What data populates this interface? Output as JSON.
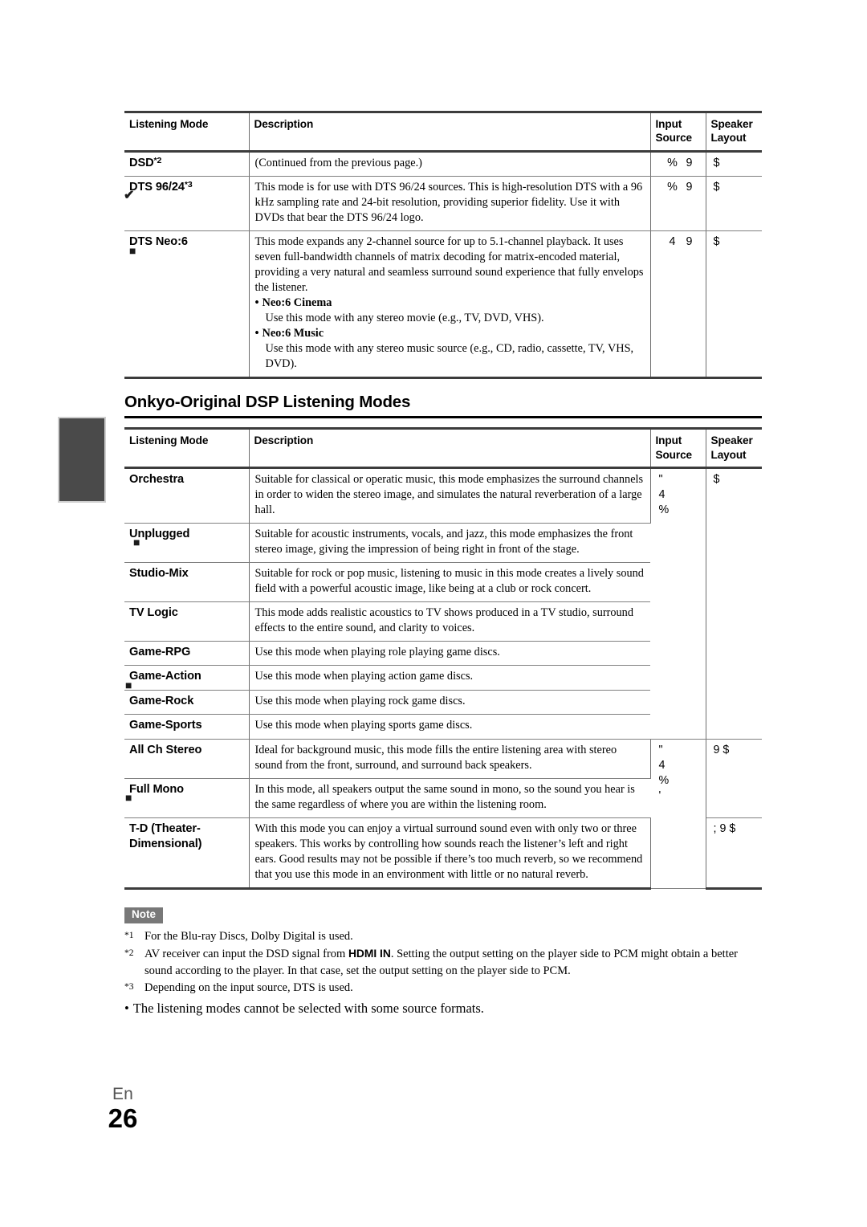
{
  "page": {
    "language_label": "En",
    "page_number": "26"
  },
  "section_heading": "Onkyo-Original DSP Listening Modes",
  "table_headers": {
    "mode": "Listening Mode",
    "description": "Description",
    "input_source_line1": "Input",
    "input_source_line2": "Source",
    "speaker_layout_line1": "Speaker",
    "speaker_layout_line2": "Layout"
  },
  "table1": {
    "rows": [
      {
        "mode": "DSD",
        "mode_sup": "*2",
        "description": "(Continued from the previous page.)",
        "input_source": [
          "%",
          "9"
        ],
        "speaker_layout": "$"
      },
      {
        "mode": "DTS 96/24",
        "mode_sup": "*3",
        "description": "This mode is for use with DTS 96/24 sources. This is high-resolution DTS with a 96 kHz sampling rate and 24-bit resolution, providing superior fidelity. Use it with DVDs that bear the DTS 96/24 logo.",
        "input_source": [
          "%",
          "9"
        ],
        "speaker_layout": "$"
      },
      {
        "mode": "DTS Neo:6",
        "mode_sup": "",
        "description": "This mode expands any 2-channel source for up to 5.1-channel playback. It uses seven full-bandwidth channels of matrix decoding for matrix-encoded material, providing a very natural and seamless surround sound experience that fully envelops the listener.",
        "bullets": [
          {
            "head": "Neo:6 Cinema",
            "body": "Use this mode with any stereo movie (e.g., TV, DVD, VHS)."
          },
          {
            "head": "Neo:6 Music",
            "body": "Use this mode with any stereo music source (e.g., CD, radio, cassette, TV, VHS, DVD)."
          }
        ],
        "input_source": [
          "4",
          "9"
        ],
        "speaker_layout": "$"
      }
    ]
  },
  "table2": {
    "rows": [
      {
        "mode": "Orchestra",
        "description": "Suitable for classical or operatic music, this mode emphasizes the surround channels in order to widen the stereo image, and simulates the natural reverberation of a large hall.",
        "input_source_stack": [
          "\"",
          "4",
          "%"
        ],
        "speaker_layout": "$"
      },
      {
        "mode": "Unplugged",
        "description": "Suitable for acoustic instruments, vocals, and jazz, this mode emphasizes the front stereo image, giving the impression of being right in front of the stage."
      },
      {
        "mode": "Studio-Mix",
        "description": "Suitable for rock or pop music, listening to music in this mode creates a lively sound field with a powerful acoustic image, like being at a club or rock concert."
      },
      {
        "mode": "TV Logic",
        "description": "This mode adds realistic acoustics to TV shows produced in a TV studio, surround effects to the entire sound, and clarity to voices."
      },
      {
        "mode": "Game-RPG",
        "description": "Use this mode when playing role playing game discs."
      },
      {
        "mode": "Game-Action",
        "description": "Use this mode when playing action game discs."
      },
      {
        "mode": "Game-Rock",
        "description": "Use this mode when playing rock game discs."
      },
      {
        "mode": "Game-Sports",
        "description": "Use this mode when playing sports game discs."
      },
      {
        "mode": "All Ch Stereo",
        "description": "Ideal for background music, this mode fills the entire listening area with stereo sound from the front, surround, and surround back speakers.",
        "input_source_stack": [
          "\"",
          "4",
          "%",
          "'"
        ],
        "speaker_layout": "9 $"
      },
      {
        "mode": "Full Mono",
        "description": "In this mode, all speakers output the same sound in mono, so the sound you hear is the same regardless of where you are within the listening room."
      },
      {
        "mode": "T-D (Theater-",
        "mode_line2": "Dimensional)",
        "description": "With this mode you can enjoy a virtual surround sound even with only two or three speakers. This works by controlling how sounds reach the listener’s left and right ears. Good results may not be possible if there’s too much reverb, so we recommend that you use this mode in an environment with little or no natural reverb.",
        "speaker_layout_stack": [
          "; 9",
          "$"
        ]
      }
    ]
  },
  "note": {
    "badge": "Note",
    "items": [
      {
        "marker": "*1",
        "text": "For the Blu-ray Discs, Dolby Digital is used."
      },
      {
        "marker": "*2",
        "pre": "AV receiver can input the DSD signal from ",
        "bold": "HDMI IN",
        "post": ". Setting the output setting on the player side to PCM might obtain a better sound according to the player. In that case, set the output setting on the player side to PCM."
      },
      {
        "marker": "*3",
        "text": "Depending on the input source, DTS is used."
      }
    ],
    "bullet": "The listening modes cannot be selected with some source formats."
  },
  "colors": {
    "placeholder_box": "#d2d2d2",
    "note_badge_bg": "#787878",
    "side_tab": "#4a4a4a",
    "rule": "#3c3c3c"
  }
}
